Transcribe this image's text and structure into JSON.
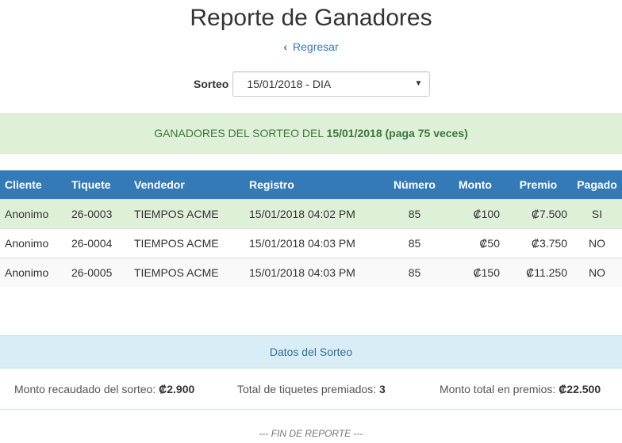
{
  "page": {
    "title": "Reporte de Ganadores",
    "back_label": "Regresar",
    "footer": "--- FIN DE REPORTE ---"
  },
  "sorteo": {
    "label": "Sorteo",
    "selected": "15/01/2018 - DIA"
  },
  "banner": {
    "prefix": "GANADORES DEL SORTEO DEL",
    "date": "15/01/2018",
    "paga": "(paga 75 veces)"
  },
  "table": {
    "headers": [
      "Cliente",
      "Tiquete",
      "Vendedor",
      "Registro",
      "Número",
      "Monto",
      "Premio",
      "Pagado"
    ],
    "rows": [
      [
        "Anonimo",
        "26-0003",
        "TIEMPOS ACME",
        "15/01/2018 04:02 PM",
        "85",
        "₡100",
        "₡7.500",
        "SI"
      ],
      [
        "Anonimo",
        "26-0004",
        "TIEMPOS ACME",
        "15/01/2018 04:03 PM",
        "85",
        "₡50",
        "₡3.750",
        "NO"
      ],
      [
        "Anonimo",
        "26-0005",
        "TIEMPOS ACME",
        "15/01/2018 04:03 PM",
        "85",
        "₡150",
        "₡11.250",
        "NO"
      ]
    ]
  },
  "datos": {
    "heading": "Datos del Sorteo",
    "recaudado_label": "Monto recaudado del sorteo:",
    "recaudado_value": "₡2.900",
    "tiquetes_label": "Total de tiquetes premiados:",
    "tiquetes_value": "3",
    "premios_label": "Monto total en premios:",
    "premios_value": "₡22.500"
  },
  "colors": {
    "primary": "#337ab7",
    "success_bg": "#dff0d8",
    "success_text": "#3c763d",
    "info_bg": "#d9edf7",
    "info_text": "#31708f"
  },
  "icons": {
    "back": "chevron-left-icon",
    "dropdown": "caret-down-icon"
  }
}
